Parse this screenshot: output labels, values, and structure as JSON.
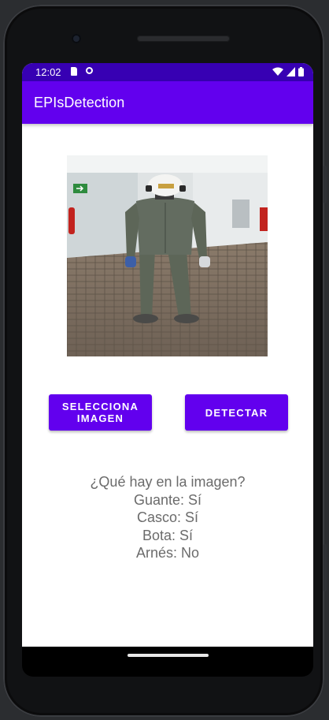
{
  "status_bar": {
    "time": "12:02",
    "icons": [
      "sd-card-icon",
      "app-notification-icon",
      "wifi-icon",
      "signal-icon",
      "battery-icon"
    ]
  },
  "app_bar": {
    "title": "EPIsDetection"
  },
  "image": {
    "description_icon": "photo-worker"
  },
  "buttons": {
    "select_image": "SELECCIONA IMAGEN",
    "detect": "DETECTAR"
  },
  "results": {
    "question": "¿Qué hay en la imagen?",
    "glove": "Guante: Sí",
    "helmet": "Casco: Sí",
    "boot": "Bota: Sí",
    "harness": "Arnés: No"
  },
  "colors": {
    "primary": "#6200ee",
    "primary_dark": "#3700b3",
    "result_text": "#6b6b6b"
  }
}
